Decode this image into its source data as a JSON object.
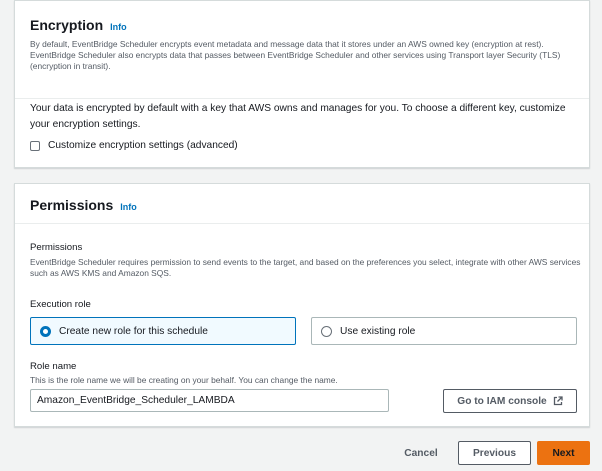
{
  "encryption": {
    "title": "Encryption",
    "info": "Info",
    "description": "By default, EventBridge Scheduler encrypts event metadata and message data that it stores under an AWS owned key (encryption at rest). EventBridge Scheduler also encrypts data that passes between EventBridge Scheduler and other services using Transport layer Security (TLS) (encryption in transit).",
    "body": "Your data is encrypted by default with a key that AWS owns and manages for you. To choose a different key, customize your encryption settings.",
    "customize_label": "Customize encryption settings (advanced)",
    "customize_checked": false
  },
  "permissions": {
    "title": "Permissions",
    "info": "Info",
    "section_label": "Permissions",
    "section_description": "EventBridge Scheduler requires permission to send events to the target, and based on the preferences you select, integrate with other AWS services such as AWS KMS and Amazon SQS.",
    "execution_role_label": "Execution role",
    "options": [
      {
        "label": "Create new role for this schedule",
        "selected": true
      },
      {
        "label": "Use existing role",
        "selected": false
      }
    ],
    "role_name_label": "Role name",
    "role_name_description": "This is the role name we will be creating on your behalf. You can change the name.",
    "role_name_value": "Amazon_EventBridge_Scheduler_LAMBDA",
    "iam_button": "Go to IAM console",
    "iam_icon": "external-link-icon"
  },
  "footer": {
    "cancel": "Cancel",
    "previous": "Previous",
    "next": "Next"
  },
  "colors": {
    "link": "#0073bb",
    "primary_button": "#ec7211",
    "selected_border": "#0073bb"
  }
}
